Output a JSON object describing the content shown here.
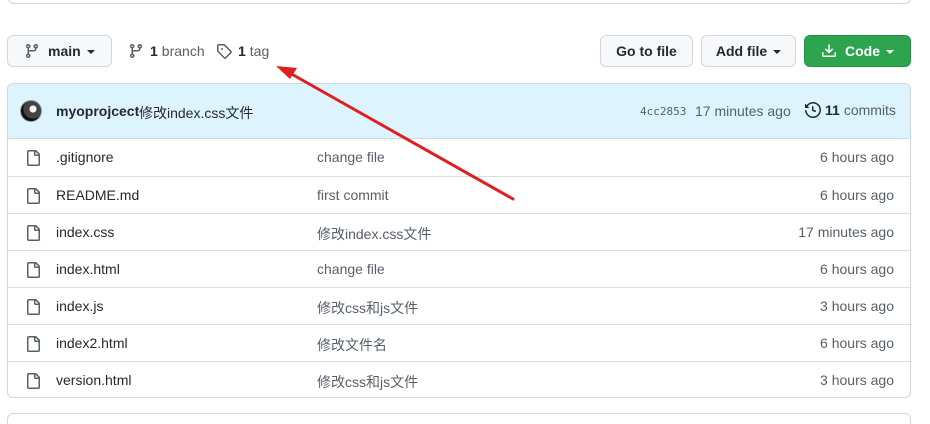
{
  "toolbar": {
    "branch_name": "main",
    "branches_count": "1",
    "branches_label": "branch",
    "tags_count": "1",
    "tags_label": "tag",
    "goto_file_label": "Go to file",
    "add_file_label": "Add file",
    "code_label": "Code",
    "code_color": "#2da44e"
  },
  "latest_commit": {
    "author": "myoprojcect",
    "message": "修改index.css文件",
    "sha": "4cc2853",
    "time": "17 minutes ago",
    "commits_count": "11",
    "commits_label": "commits",
    "banner_color": "#ddf4ff"
  },
  "files": [
    {
      "name": ".gitignore",
      "message": "change file",
      "time": "6 hours ago"
    },
    {
      "name": "README.md",
      "message": "first commit",
      "time": "6 hours ago"
    },
    {
      "name": "index.css",
      "message": "修改index.css文件",
      "time": "17 minutes ago"
    },
    {
      "name": "index.html",
      "message": "change file",
      "time": "6 hours ago"
    },
    {
      "name": "index.js",
      "message": "修改css和js文件",
      "time": "3 hours ago"
    },
    {
      "name": "index2.html",
      "message": "修改文件名",
      "time": "6 hours ago"
    },
    {
      "name": "version.html",
      "message": "修改css和js文件",
      "time": "3 hours ago"
    }
  ],
  "icons": {
    "branch": "git-branch-icon",
    "tag": "tag-icon",
    "download": "download-icon",
    "history": "history-icon",
    "file": "file-icon",
    "annotation": "red-arrow-annotation"
  },
  "annotation_color": "#e02020"
}
